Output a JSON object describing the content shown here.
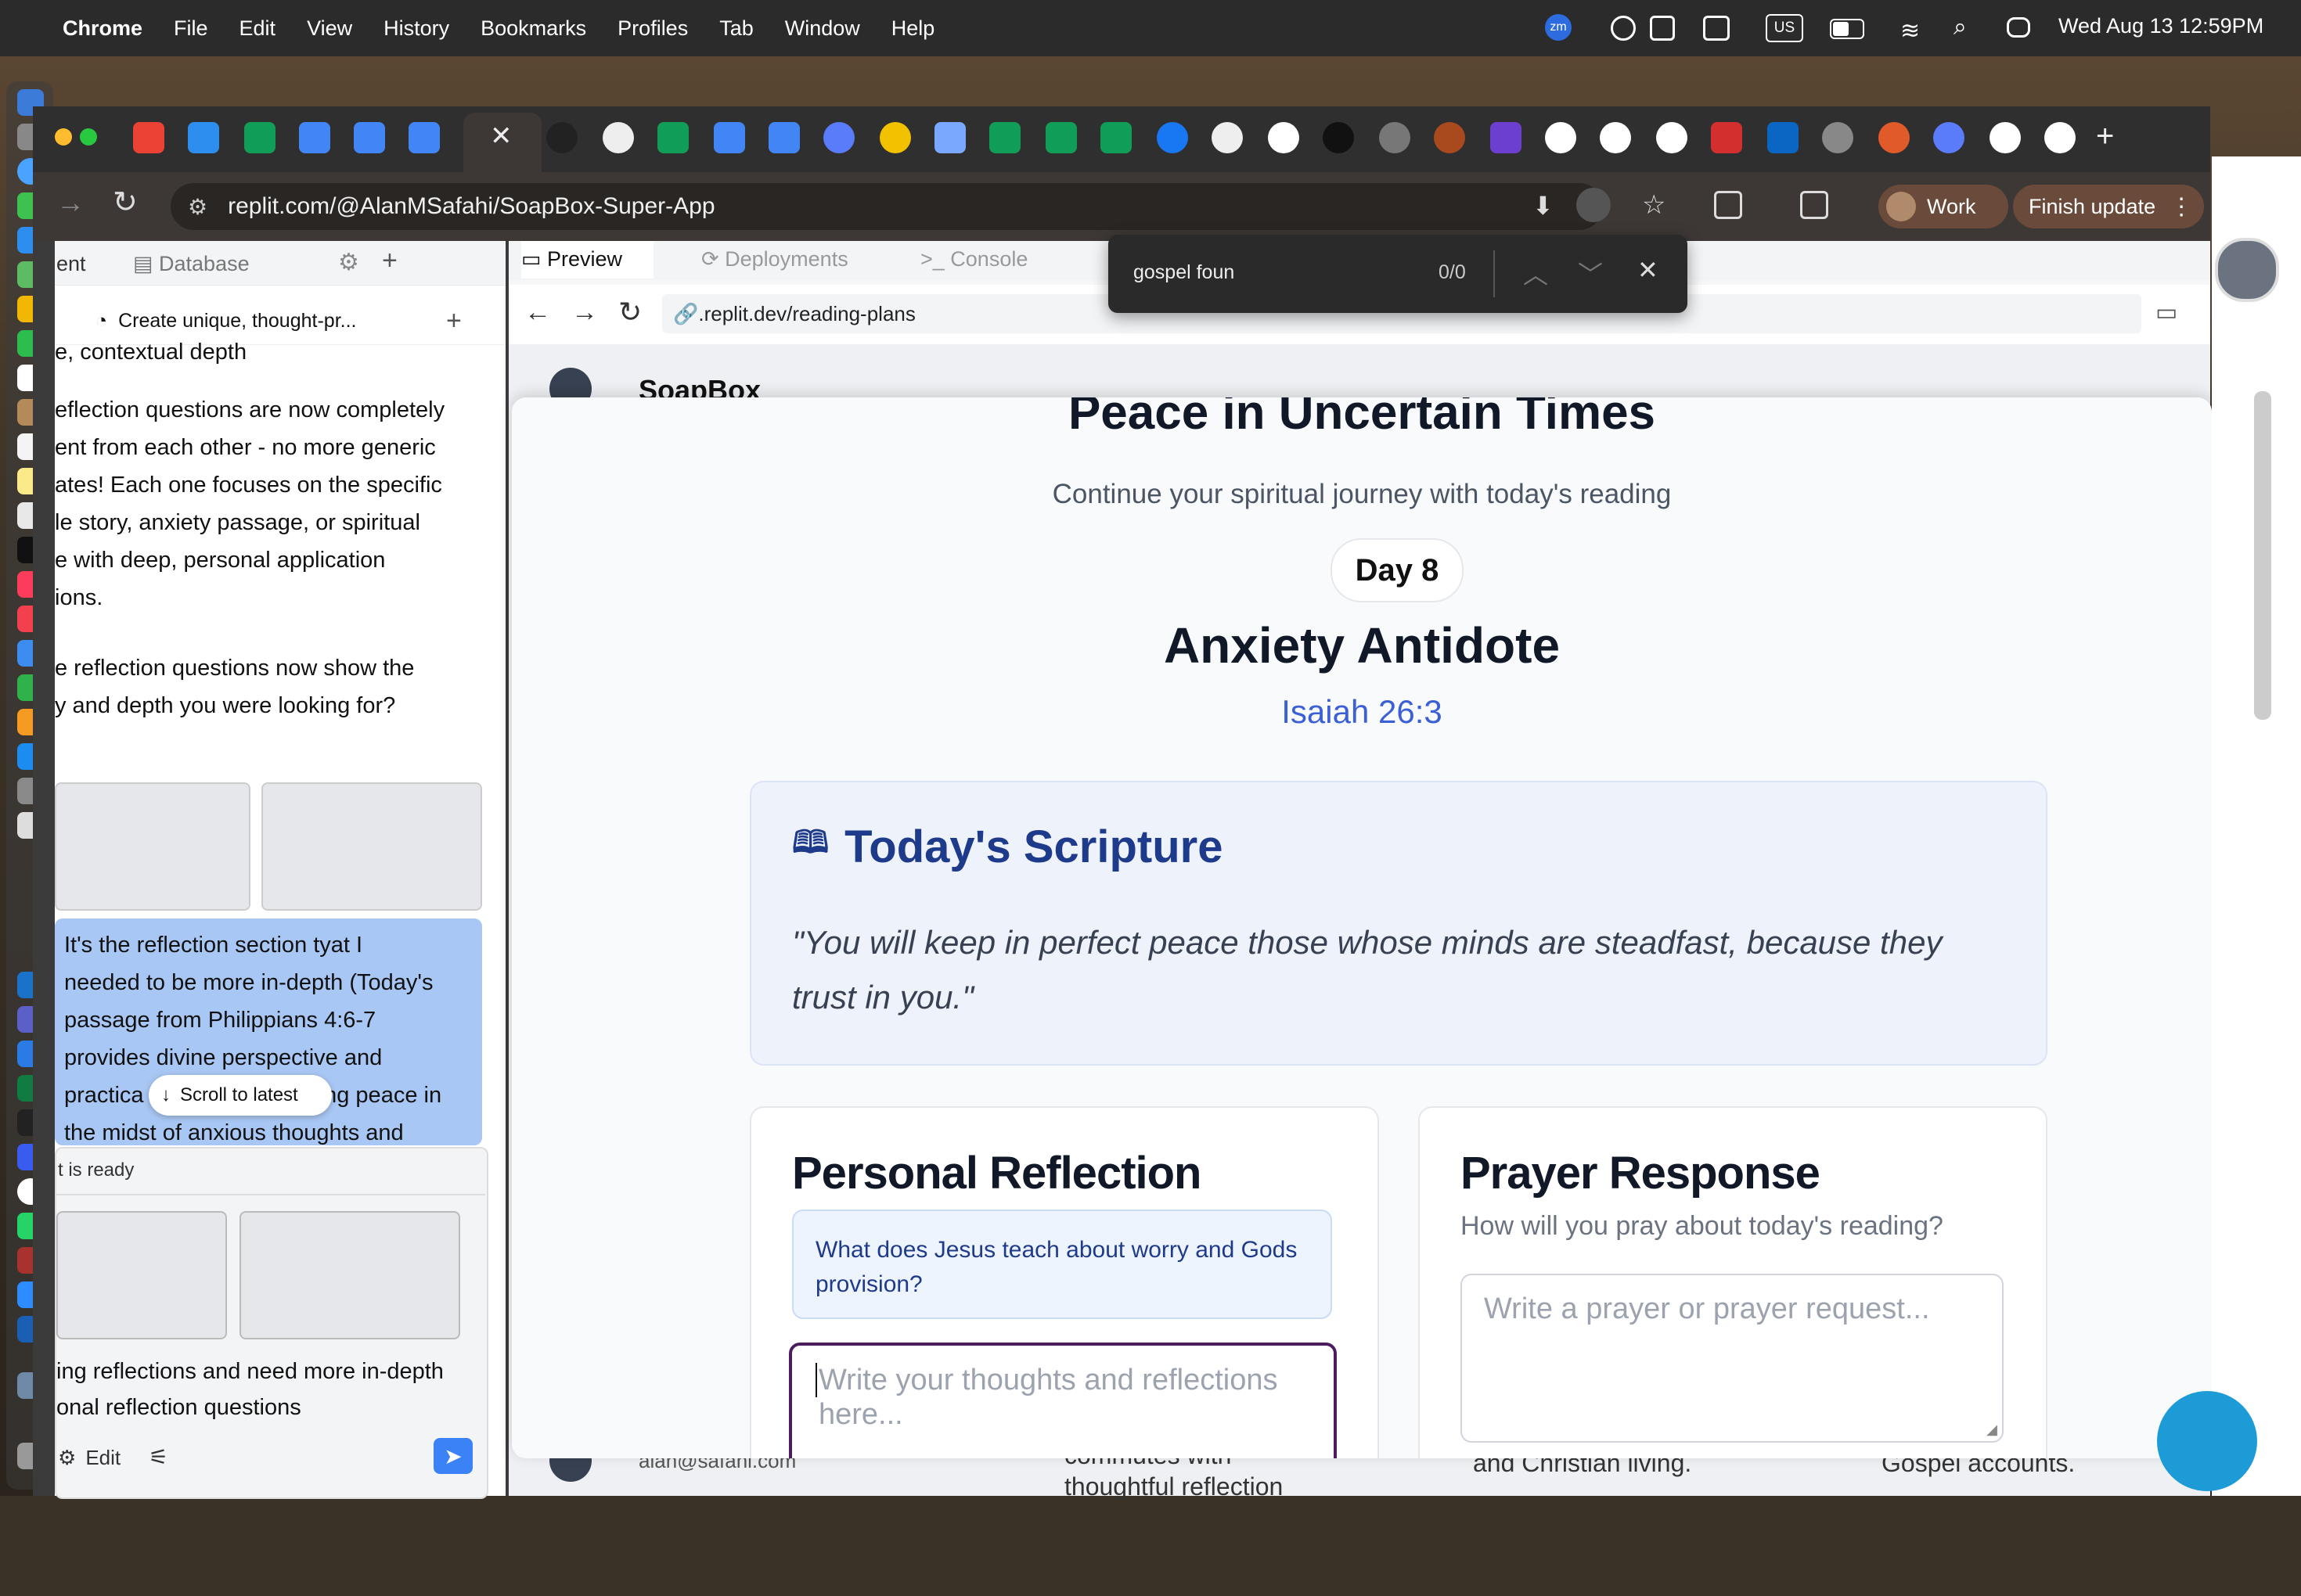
{
  "menubar": {
    "apple": "",
    "app": "Chrome",
    "items": [
      "File",
      "Edit",
      "View",
      "History",
      "Bookmarks",
      "Profiles",
      "Tab",
      "Window",
      "Help"
    ],
    "status": {
      "zoom": "zm",
      "input": "US",
      "clock": "Wed Aug 13  12:59PM"
    }
  },
  "browser": {
    "url": "replit.com/@AlanMSafahi/SoapBox-Super-App",
    "profile": "Work",
    "update_label": "Finish update",
    "find": {
      "query": "gospel foun",
      "count": "0/0"
    }
  },
  "replit": {
    "left_tabs": [
      "ent",
      "Database"
    ],
    "chat_title": "Create unique, thought-pr...",
    "chat_lines": [
      "e, contextual depth",
      "eflection questions are now completely",
      "ent from each other - no more generic",
      "ates! Each one focuses on the specific",
      "le story, anxiety passage, or spiritual",
      "e with deep, personal application",
      "ions.",
      "e reflection questions now show the",
      "y and depth you were looking for?"
    ],
    "user_bubble": [
      "It's the reflection section tyat I",
      "needed to be more in-depth (Today's",
      "passage from Philippians 4:6-7",
      "provides divine perspective and",
      "practica",
      "ding peace in",
      "the midst of anxious thoughts and"
    ],
    "scroll_latest": "Scroll to latest",
    "ready_label": "t is ready",
    "composer_lines": [
      "ing reflections and need more in-depth",
      "onal reflection questions"
    ],
    "edit_label": "Edit",
    "right_tabs": [
      "Preview",
      "Deployments",
      "Console"
    ],
    "preview_url": ".replit.dev/reading-plans",
    "bg_brand": "SoapBox",
    "bg_email": "alan@safahi.com",
    "bg_bottom": [
      "commutes with",
      "thoughtful reflection",
      "and Christian living.",
      "Gospel accounts."
    ]
  },
  "modal": {
    "plan_title": "Peace in Uncertain Times",
    "subtitle": "Continue your spiritual journey with today's reading",
    "day": "Day 8",
    "reading_title": "Anxiety Antidote",
    "reference": "Isaiah 26:3",
    "scripture_heading": "Today's Scripture",
    "scripture_text": "\"You will keep in perfect peace those whose minds are steadfast, because they trust in you.\"",
    "reflection_heading": "Personal Reflection",
    "reflection_question": "What does Jesus teach about worry and Gods provision?",
    "reflection_placeholder": "Write your thoughts and reflections here...",
    "prayer_heading": "Prayer Response",
    "prayer_sub": "How will you pray about today's reading?",
    "prayer_placeholder": "Write a prayer or prayer request..."
  },
  "colors": {
    "accent_blue": "#3b5fd6",
    "scripture_blue": "#1e3a8a",
    "heading": "#111827",
    "muted": "#4b5563",
    "reflection_border": "#4c1d5e"
  }
}
